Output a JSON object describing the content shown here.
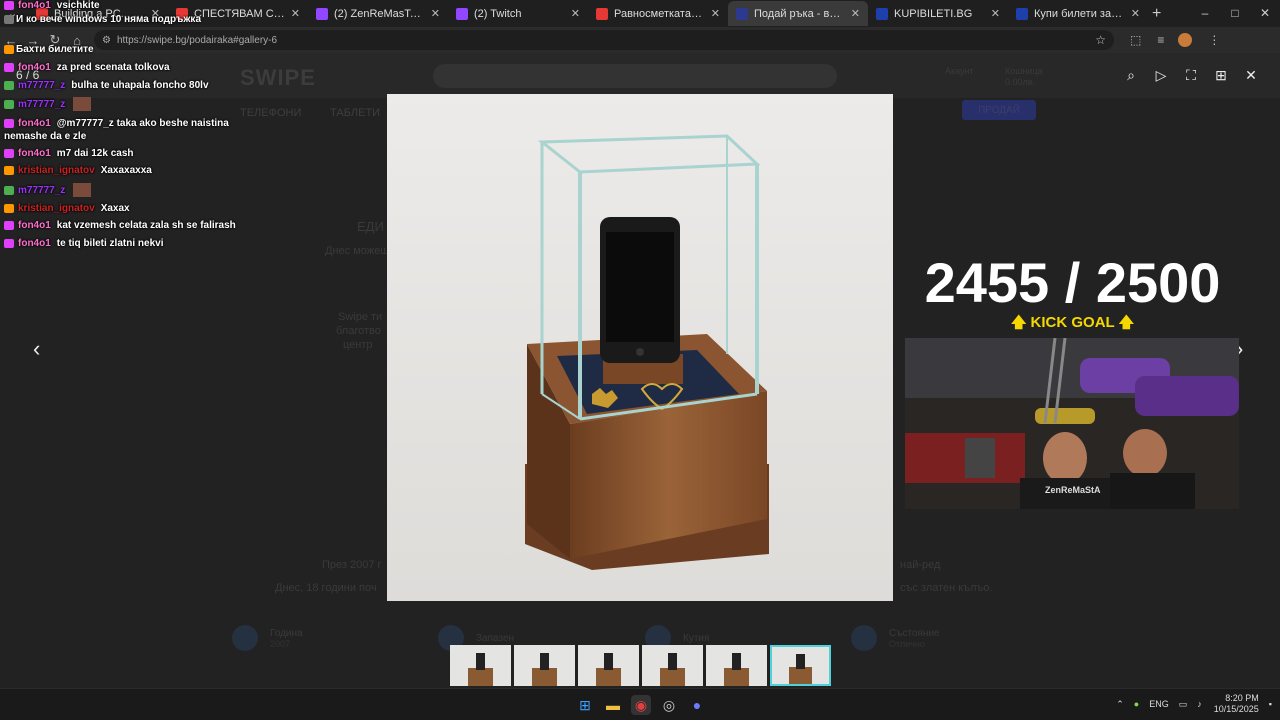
{
  "browser": {
    "tabs": [
      {
        "title": "Building a PC... Using Only tl",
        "color": "#e53935"
      },
      {
        "title": "СПЕСТЯВАМ СИ РЕМОНТ за",
        "color": "#e53935"
      },
      {
        "title": "(2) ZenReMasTa - Twitch",
        "color": "#9146ff"
      },
      {
        "title": "(2) Twitch",
        "color": "#9146ff"
      },
      {
        "title": "Равносметката - \"Къщата н",
        "color": "#e53935"
      },
      {
        "title": "Подай ръка - включи се в",
        "color": "#2b3a8f",
        "active": true
      },
      {
        "title": "KUPIBILETI.BG",
        "color": "#1e40af"
      },
      {
        "title": "Купи билети за КЪЩАТА Н",
        "color": "#1e40af"
      }
    ],
    "new_tab": "+",
    "url": "https://swipe.bg/podairaka#gallery-6",
    "controls": {
      "minimize": "–",
      "maximize": "□",
      "close": "✕"
    }
  },
  "site": {
    "logo": "SWIPE",
    "search_placeholder": "",
    "account_label": "Акаунт",
    "cart_label": "Кошница",
    "cart_value": "0.00лв.",
    "nav_phones": "ТЕЛЕФОНИ",
    "nav_tablets": "ТАБЛЕТИ",
    "sell_button": "ПРОДАЙ",
    "heading_part": "ЕДИ",
    "sub_part": "Днес можеш",
    "para1": "Swipe ти",
    "para2": "благотво",
    "para3": "центр",
    "bottom_text_left": "През 2007 г",
    "bottom_text_left2": "Днес, 18 години поч",
    "bottom_text_right": "най-ред",
    "bottom_text_right2": "със златен кълъо.",
    "stats": [
      {
        "title": "Година",
        "value": "2007"
      },
      {
        "title": "Запазен",
        "value": ""
      },
      {
        "title": "Кутия",
        "value": ""
      },
      {
        "title": "Състояние",
        "value": "Отлично"
      }
    ]
  },
  "lightbox": {
    "counter": "6 / 6",
    "tools": [
      "search-icon",
      "play-icon",
      "fullscreen-icon",
      "grid-icon",
      "close-icon"
    ],
    "prev": "‹",
    "next": "›",
    "thumb_count": 6,
    "active_thumb": 6
  },
  "chat": [
    {
      "user": "fon4o1",
      "msg": "vsichkite",
      "color": "#ff6fd0",
      "badge": "#e040fb"
    },
    {
      "user": "",
      "msg": "И ко вече windows 10 няма подръжка",
      "color": "#cc2222",
      "badge": "#777"
    },
    {
      "user": "",
      "msg": "Бахти билетите",
      "color": "#cc2222",
      "badge": "#ff9800"
    },
    {
      "user": "fon4o1",
      "msg": "za pred scenata tolkova",
      "color": "#ff6fd0",
      "badge": "#e040fb"
    },
    {
      "user": "m77777_z",
      "msg": "bulha te uhapala foncho 80lv",
      "color": "#9b30ff",
      "badge": "#4caf50"
    },
    {
      "user": "m77777_z",
      "msg": "",
      "color": "#9b30ff",
      "badge": "#4caf50",
      "emote": true
    },
    {
      "user": "fon4o1",
      "msg": "@m77777_z taka ako beshe naistina",
      "color": "#ff6fd0",
      "badge": "#e040fb"
    },
    {
      "user": "",
      "msg": "nemashe da e zle",
      "color": "#fff",
      "badge": ""
    },
    {
      "user": "fon4o1",
      "msg": "m7 dai 12k cash",
      "color": "#ff6fd0",
      "badge": "#e040fb"
    },
    {
      "user": "kristian_ignatov",
      "msg": "Xaxaxaxxa",
      "color": "#cc2222",
      "badge": "#ff9800"
    },
    {
      "user": "m77777_z",
      "msg": "",
      "color": "#9b30ff",
      "badge": "#4caf50",
      "emote": true
    },
    {
      "user": "kristian_ignatov",
      "msg": "Xaxax",
      "color": "#cc2222",
      "badge": "#ff9800"
    },
    {
      "user": "fon4o1",
      "msg": "kat vzemesh celata zala sh se falirash",
      "color": "#ff6fd0",
      "badge": "#e040fb"
    },
    {
      "user": "fon4o1",
      "msg": "te tiq bileti zlatni nekvi",
      "color": "#ff6fd0",
      "badge": "#e040fb"
    }
  ],
  "goal": {
    "current": "2455",
    "separator": " / ",
    "target": "2500",
    "label": "KICK GOAL"
  },
  "taskbar": {
    "tray_lang": "ENG",
    "time": "8:20 PM",
    "date": "10/15/2025"
  }
}
